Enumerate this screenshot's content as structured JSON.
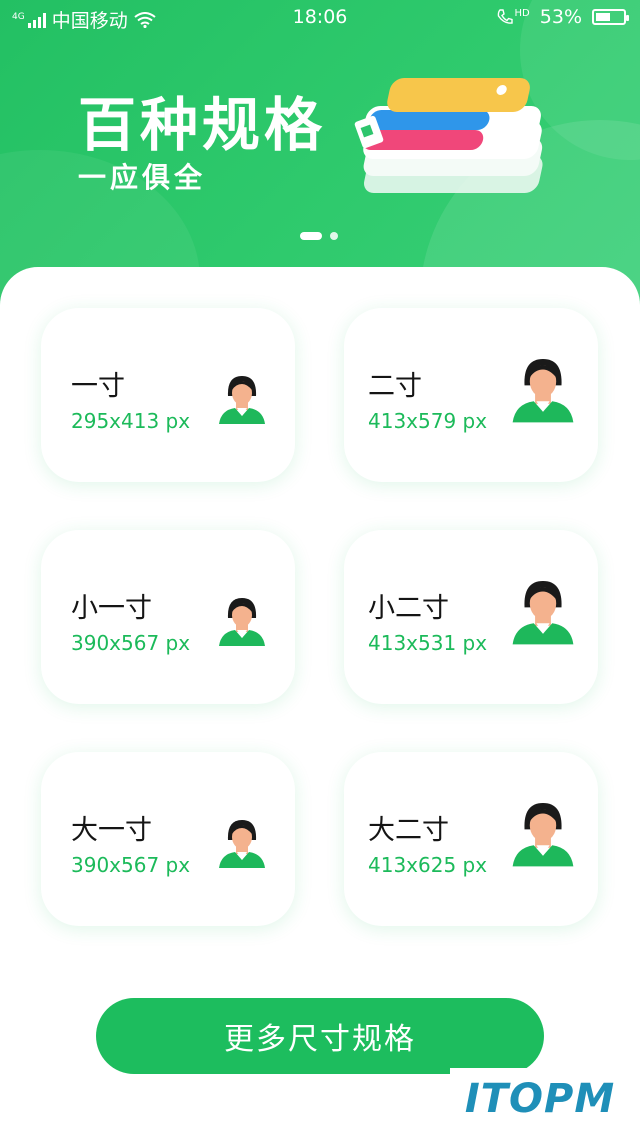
{
  "status_bar": {
    "network": "4G",
    "carrier": "中国移动",
    "time": "18:06",
    "hd_label": "HD",
    "battery": "53%",
    "battery_level": 0.53
  },
  "banner": {
    "title": "百种规格",
    "subtitle": "一应俱全",
    "active_slide": 1,
    "slide_count": 2
  },
  "size_cards": [
    {
      "name": "一寸",
      "size": "295x413 px"
    },
    {
      "name": "二寸",
      "size": "413x579 px"
    },
    {
      "name": "小一寸",
      "size": "390x567 px"
    },
    {
      "name": "小二寸",
      "size": "413x531 px"
    },
    {
      "name": "大一寸",
      "size": "390x567 px"
    },
    {
      "name": "大二寸",
      "size": "413x625 px"
    }
  ],
  "more_button": {
    "label": "更多尺寸规格"
  },
  "watermark": {
    "text": "ITOPM"
  },
  "colors": {
    "brand_green": "#1dbd5e",
    "size_text": "#1cba5a",
    "avatar_shirt": "#1eb85b",
    "avatar_skin": "#f4b28e"
  }
}
